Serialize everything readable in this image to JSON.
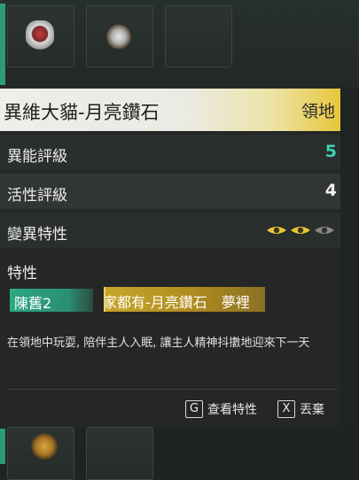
{
  "item": {
    "name": "異維大貓-月亮鑽石",
    "tag": "領地"
  },
  "stats": [
    {
      "label": "異能評級",
      "value": "5",
      "color": "#3fd3b2"
    },
    {
      "label": "活性評級",
      "value": "4",
      "color": "#f0f0ec"
    }
  ],
  "mutation": {
    "label": "變異特性",
    "eye_icons": [
      "eye-icon",
      "eye-icon",
      "eye-icon"
    ],
    "active_color": "#e8c832",
    "inactive_color": "#8a8a86",
    "active_count": 2,
    "total_count": 3
  },
  "traits": {
    "label": "特性",
    "chips": [
      {
        "text": "陳舊2",
        "color": "#2ea884"
      },
      {
        "text": "家都有-月亮鑽石　夢裡",
        "color": "#c7a52b"
      }
    ]
  },
  "description": "在領地中玩耍, 陪伴主人入眠, 讓主人精神抖擻地迎來下一天",
  "actions": [
    {
      "key": "G",
      "label": "查看特性",
      "icon": "g-key-icon"
    },
    {
      "key": "X",
      "label": "丟棄",
      "icon": "x-key-icon"
    }
  ]
}
